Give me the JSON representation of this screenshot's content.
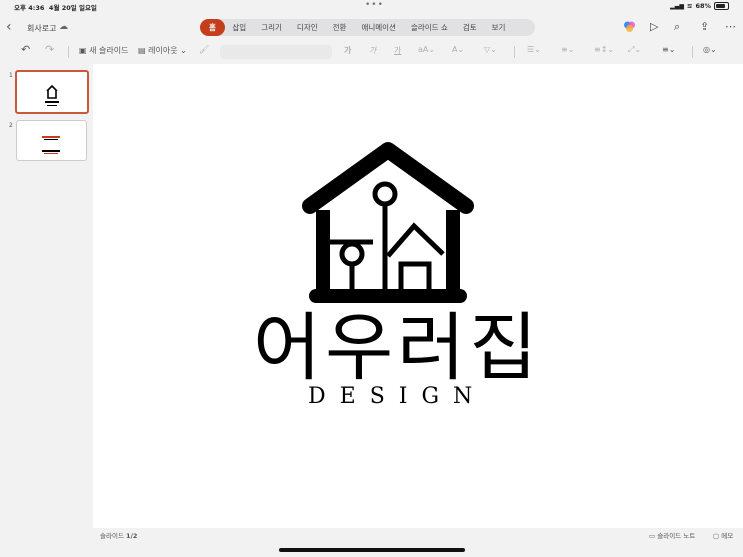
{
  "status": {
    "time": "오후 4:36",
    "date": "4월 20일 일요일",
    "battery": "68%"
  },
  "title": {
    "doc_name": "회사로고"
  },
  "tabs": [
    {
      "label": "홈",
      "active": true
    },
    {
      "label": "삽입"
    },
    {
      "label": "그리기"
    },
    {
      "label": "디자인"
    },
    {
      "label": "전환"
    },
    {
      "label": "애니메이션"
    },
    {
      "label": "슬라이드 쇼"
    },
    {
      "label": "검토"
    },
    {
      "label": "보기"
    }
  ],
  "toolbar": {
    "new_slide": "새 슬라이드",
    "layout": "레이아웃",
    "bold": "가",
    "italic": "가",
    "underline": "가"
  },
  "slides_panel": {
    "items": [
      {
        "number": "1",
        "selected": true
      },
      {
        "number": "2",
        "selected": false
      }
    ]
  },
  "slide": {
    "logo_korean": "어우러집",
    "logo_english": "DESIGN"
  },
  "bottom": {
    "slide_label": "슬라이드",
    "slide_pos": "1/2",
    "notes": "슬라이드 노트",
    "memo": "메모"
  },
  "colors": {
    "accent": "#c43e1c",
    "background": "#f2f2f3"
  }
}
